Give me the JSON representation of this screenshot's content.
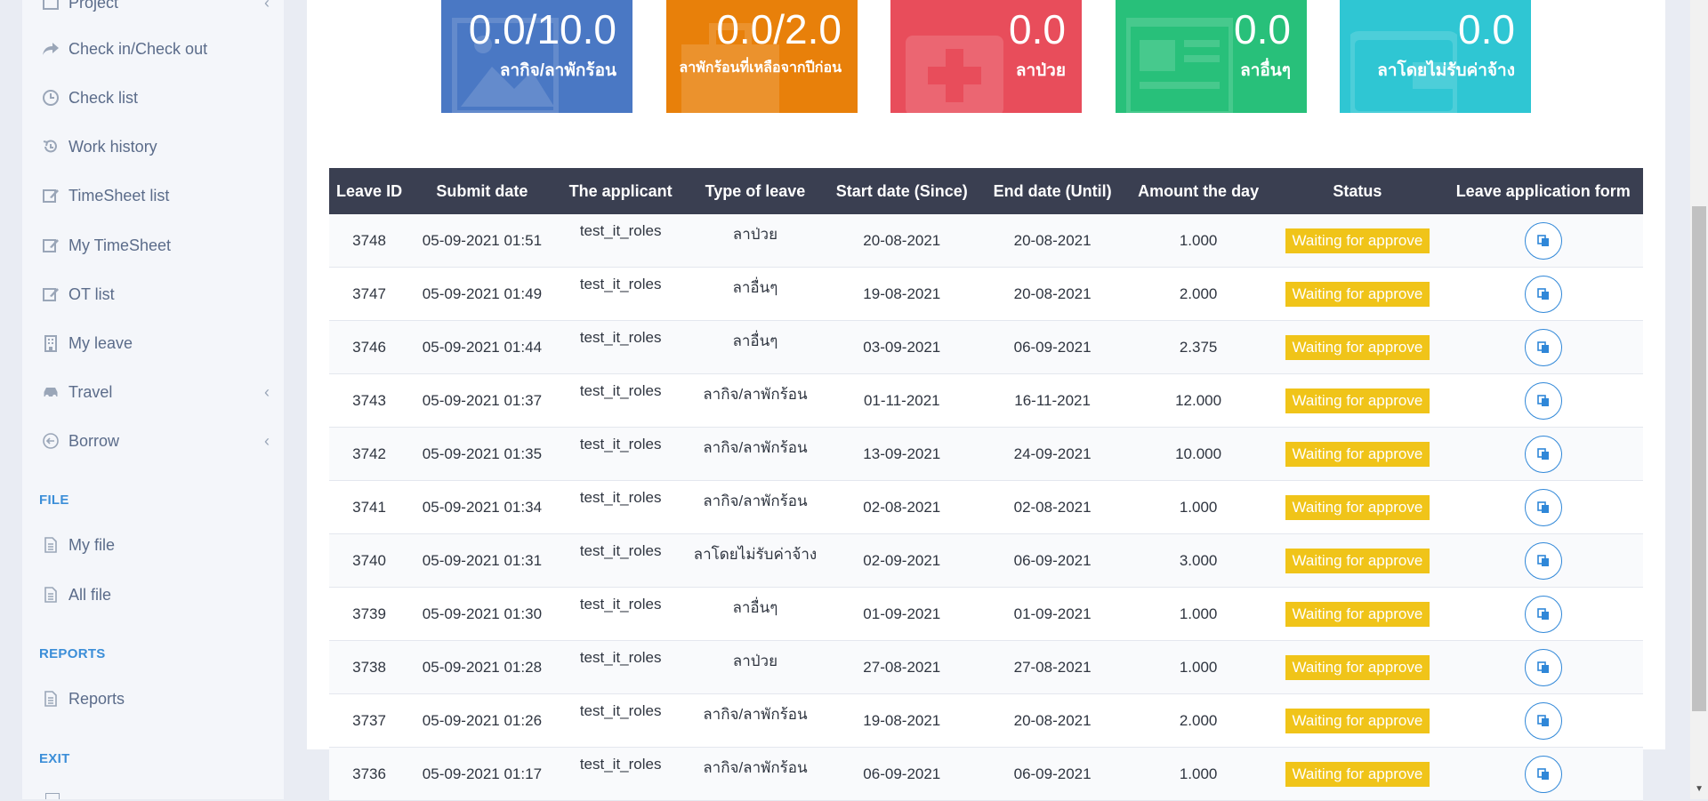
{
  "sidebar": {
    "items": [
      {
        "label": "Project",
        "icon": "project-icon"
      },
      {
        "label": "Check in/Check out",
        "icon": "share-arrow-icon"
      },
      {
        "label": "Check list",
        "icon": "clock-icon"
      },
      {
        "label": "Work history",
        "icon": "history-icon"
      },
      {
        "label": "TimeSheet list",
        "icon": "edit-icon"
      },
      {
        "label": "My TimeSheet",
        "icon": "edit-icon"
      },
      {
        "label": "OT list",
        "icon": "edit-icon"
      },
      {
        "label": "My leave",
        "icon": "building-icon"
      },
      {
        "label": "Travel",
        "icon": "car-icon"
      },
      {
        "label": "Borrow",
        "icon": "arrow-circle-icon"
      }
    ],
    "file_title": "FILE",
    "file_items": [
      {
        "label": "My file",
        "icon": "file-icon"
      },
      {
        "label": "All file",
        "icon": "file-icon"
      }
    ],
    "reports_title": "REPORTS",
    "reports_items": [
      {
        "label": "Reports",
        "icon": "file-icon"
      }
    ],
    "exit_title": "EXIT"
  },
  "cards": [
    {
      "value": "0.0/10.0",
      "label": "ลากิจ/ลาพักร้อน",
      "color": "#4a78c4"
    },
    {
      "value": "0.0/2.0",
      "label": "ลาพักร้อนที่เหลือจากปีก่อน",
      "color": "#e8800a"
    },
    {
      "value": "0.0",
      "label": "ลาป่วย",
      "color": "#e84d5b"
    },
    {
      "value": "0.0",
      "label": "ลาอื่นๆ",
      "color": "#28c07a"
    },
    {
      "value": "0.0",
      "label": "ลาโดยไม่รับค่าจ้าง",
      "color": "#2fc6d3"
    }
  ],
  "table": {
    "headers": [
      "Leave ID",
      "Submit date",
      "The applicant",
      "Type of leave",
      "Start date (Since)",
      "End date (Until)",
      "Amount the day",
      "Status",
      "Leave application form"
    ],
    "rows": [
      {
        "id": "3748",
        "submit": "05-09-2021 01:51",
        "applicant": "test_it_roles",
        "type": "ลาป่วย",
        "start": "20-08-2021",
        "end": "20-08-2021",
        "amount": "1.000",
        "status": "Waiting for approve"
      },
      {
        "id": "3747",
        "submit": "05-09-2021 01:49",
        "applicant": "test_it_roles",
        "type": "ลาอื่นๆ",
        "start": "19-08-2021",
        "end": "20-08-2021",
        "amount": "2.000",
        "status": "Waiting for approve"
      },
      {
        "id": "3746",
        "submit": "05-09-2021 01:44",
        "applicant": "test_it_roles",
        "type": "ลาอื่นๆ",
        "start": "03-09-2021",
        "end": "06-09-2021",
        "amount": "2.375",
        "status": "Waiting for approve"
      },
      {
        "id": "3743",
        "submit": "05-09-2021 01:37",
        "applicant": "test_it_roles",
        "type": "ลากิจ/ลาพักร้อน",
        "start": "01-11-2021",
        "end": "16-11-2021",
        "amount": "12.000",
        "status": "Waiting for approve"
      },
      {
        "id": "3742",
        "submit": "05-09-2021 01:35",
        "applicant": "test_it_roles",
        "type": "ลากิจ/ลาพักร้อน",
        "start": "13-09-2021",
        "end": "24-09-2021",
        "amount": "10.000",
        "status": "Waiting for approve"
      },
      {
        "id": "3741",
        "submit": "05-09-2021 01:34",
        "applicant": "test_it_roles",
        "type": "ลากิจ/ลาพักร้อน",
        "start": "02-08-2021",
        "end": "02-08-2021",
        "amount": "1.000",
        "status": "Waiting for approve"
      },
      {
        "id": "3740",
        "submit": "05-09-2021 01:31",
        "applicant": "test_it_roles",
        "type": "ลาโดยไม่รับค่าจ้าง",
        "start": "02-09-2021",
        "end": "06-09-2021",
        "amount": "3.000",
        "status": "Waiting for approve"
      },
      {
        "id": "3739",
        "submit": "05-09-2021 01:30",
        "applicant": "test_it_roles",
        "type": "ลาอื่นๆ",
        "start": "01-09-2021",
        "end": "01-09-2021",
        "amount": "1.000",
        "status": "Waiting for approve"
      },
      {
        "id": "3738",
        "submit": "05-09-2021 01:28",
        "applicant": "test_it_roles",
        "type": "ลาป่วย",
        "start": "27-08-2021",
        "end": "27-08-2021",
        "amount": "1.000",
        "status": "Waiting for approve"
      },
      {
        "id": "3737",
        "submit": "05-09-2021 01:26",
        "applicant": "test_it_roles",
        "type": "ลากิจ/ลาพักร้อน",
        "start": "19-08-2021",
        "end": "20-08-2021",
        "amount": "2.000",
        "status": "Waiting for approve"
      },
      {
        "id": "3736",
        "submit": "05-09-2021 01:17",
        "applicant": "test_it_roles",
        "type": "ลากิจ/ลาพักร้อน",
        "start": "06-09-2021",
        "end": "06-09-2021",
        "amount": "1.000",
        "status": "Waiting for approve"
      }
    ]
  },
  "colors": {
    "status_badge": "#f0c419",
    "table_header": "#3a3f51",
    "accent": "#2f87d8"
  }
}
